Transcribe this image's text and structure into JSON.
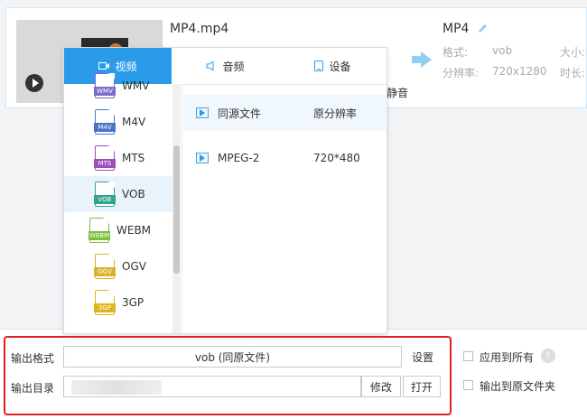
{
  "file": {
    "name": "MP4.mp4",
    "mute_label": "静音",
    "target_format": "MP4",
    "meta": {
      "format_label": "格式:",
      "format_value": "vob",
      "resolution_label": "分辨率:",
      "resolution_value": "720x1280",
      "size_label": "大小:",
      "duration_label": "时长:"
    }
  },
  "popup": {
    "tabs": [
      {
        "label": "视频",
        "icon": "video-icon",
        "active": true
      },
      {
        "label": "音频",
        "icon": "audio-icon",
        "active": false
      },
      {
        "label": "设备",
        "icon": "device-icon",
        "active": false
      }
    ],
    "formats": [
      {
        "label": "WMV",
        "icon_text": "WMV",
        "color": "#7b6cc8",
        "selected": false
      },
      {
        "label": "M4V",
        "icon_text": "M4V",
        "color": "#4a74c9",
        "selected": false
      },
      {
        "label": "MTS",
        "icon_text": "MTS",
        "color": "#9b4fb8",
        "selected": false
      },
      {
        "label": "VOB",
        "icon_text": "VOB",
        "color": "#2fa58c",
        "selected": true
      },
      {
        "label": "WEBM",
        "icon_text": "WEBM",
        "color": "#7bbf3a",
        "selected": false
      },
      {
        "label": "OGV",
        "icon_text": "OGV",
        "color": "#d8b22a",
        "selected": false
      },
      {
        "label": "3GP",
        "icon_text": "3GP",
        "color": "#e0b51c",
        "selected": false
      }
    ],
    "presets": [
      {
        "name": "同源文件",
        "resolution": "原分辨率",
        "selected": true
      },
      {
        "name": "MPEG-2",
        "resolution": "720*480",
        "selected": false
      }
    ]
  },
  "output": {
    "format_label": "输出格式",
    "format_value": "vob (同原文件)",
    "settings_button": "设置",
    "dir_label": "输出目录",
    "dir_value": "",
    "modify_button": "修改",
    "open_button": "打开",
    "apply_all_label": "应用到所有",
    "help_icon_text": "?",
    "to_source_folder_label": "输出到原文件夹"
  },
  "colors": {
    "accent": "#2a9be8",
    "highlight_border": "#e02020"
  }
}
